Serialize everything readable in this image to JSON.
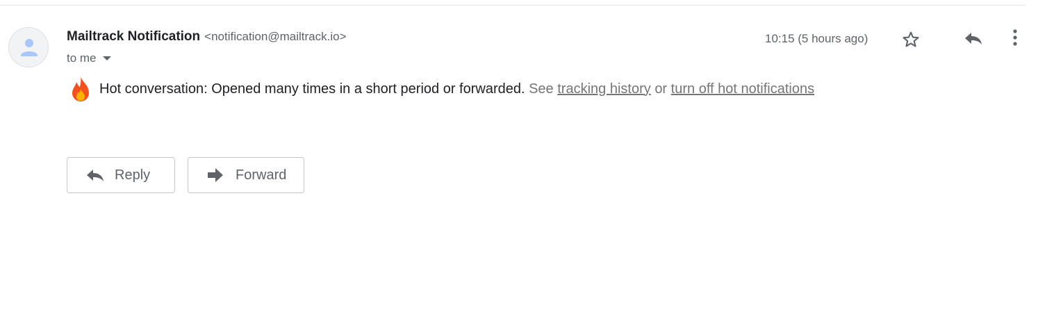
{
  "message": {
    "sender_name": "Mailtrack Notification",
    "sender_email": "<notification@mailtrack.io>",
    "recipient": "to me",
    "timestamp": "10:15 (5 hours ago)",
    "body": {
      "main": "Hot conversation: Opened many times in a short period or forwarded.",
      "see": "See",
      "link_tracking": "tracking history",
      "or": "or",
      "link_turn_off": "turn off hot notifications"
    }
  },
  "header_actions": {
    "star_icon": "star-outline-icon",
    "reply_icon": "reply-icon",
    "more_icon": "more-vert-icon"
  },
  "footer_actions": {
    "reply_label": "Reply",
    "forward_label": "Forward"
  },
  "colors": {
    "avatar_person": "#a8c7fa",
    "fire_outer": "#f4511e",
    "fire_inner": "#ffb300"
  }
}
